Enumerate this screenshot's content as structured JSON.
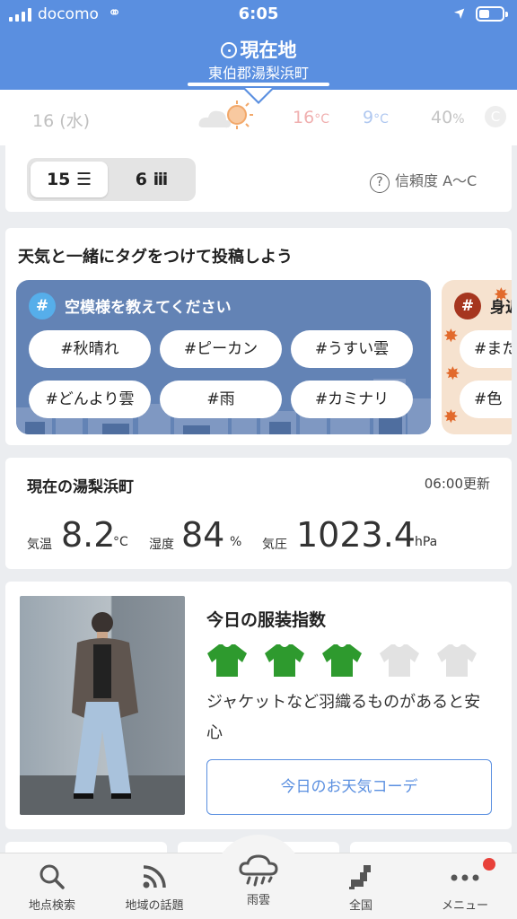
{
  "status_bar": {
    "carrier": "docomo",
    "time": "6:05"
  },
  "header": {
    "title": "現在地",
    "subtitle": "東伯郡湯梨浜町"
  },
  "forecast_row": {
    "date": "16 (水)",
    "high": "16",
    "high_unit": "°C",
    "low": "9",
    "low_unit": "°C",
    "precip": "40",
    "precip_unit": "%",
    "badge": "C"
  },
  "period_toggle": {
    "options": [
      "15 ☰",
      "6 ⅲ"
    ],
    "selected": "15 ☰"
  },
  "reliability": {
    "label": "信頼度 A～C"
  },
  "tag_section": {
    "heading": "天気と一緒にタグをつけて投稿しよう",
    "panel1": {
      "title": "空模様を教えてください",
      "tags": [
        "#秋晴れ",
        "#ピーカン",
        "#うすい雲",
        "#どんより雲",
        "#雨",
        "#カミナリ"
      ]
    },
    "panel2": {
      "title_partial": "身近",
      "tags_partial": [
        "#また",
        "#色"
      ]
    }
  },
  "current": {
    "title": "現在の湯梨浜町",
    "updated": "06:00更新",
    "temp_label": "気温",
    "temp": "8.2",
    "temp_unit": "°C",
    "humidity_label": "湿度",
    "humidity": "84",
    "humidity_unit": "%",
    "pressure_label": "気圧",
    "pressure": "1023.4",
    "pressure_unit": "hPa"
  },
  "clothing": {
    "title": "今日の服装指数",
    "level": 3,
    "max_level": 5,
    "description": "ジャケットなど羽織るものがあると安心",
    "button": "今日のお天気コーデ",
    "colors": {
      "on": "#2e9a2e",
      "off": "#e2e2e2"
    }
  },
  "tabbar": {
    "items": [
      {
        "label": "地点検索",
        "icon": "search-icon"
      },
      {
        "label": "地域の話題",
        "icon": "rss-icon"
      },
      {
        "label": "雨雲",
        "icon": "rain-cloud-icon"
      },
      {
        "label": "全国",
        "icon": "japan-map-icon"
      },
      {
        "label": "メニュー",
        "icon": "more-dots-icon"
      }
    ]
  },
  "colors": {
    "brand": "#5a8fe0",
    "tag_panel": "#6383b5",
    "notification": "#e8413a"
  }
}
